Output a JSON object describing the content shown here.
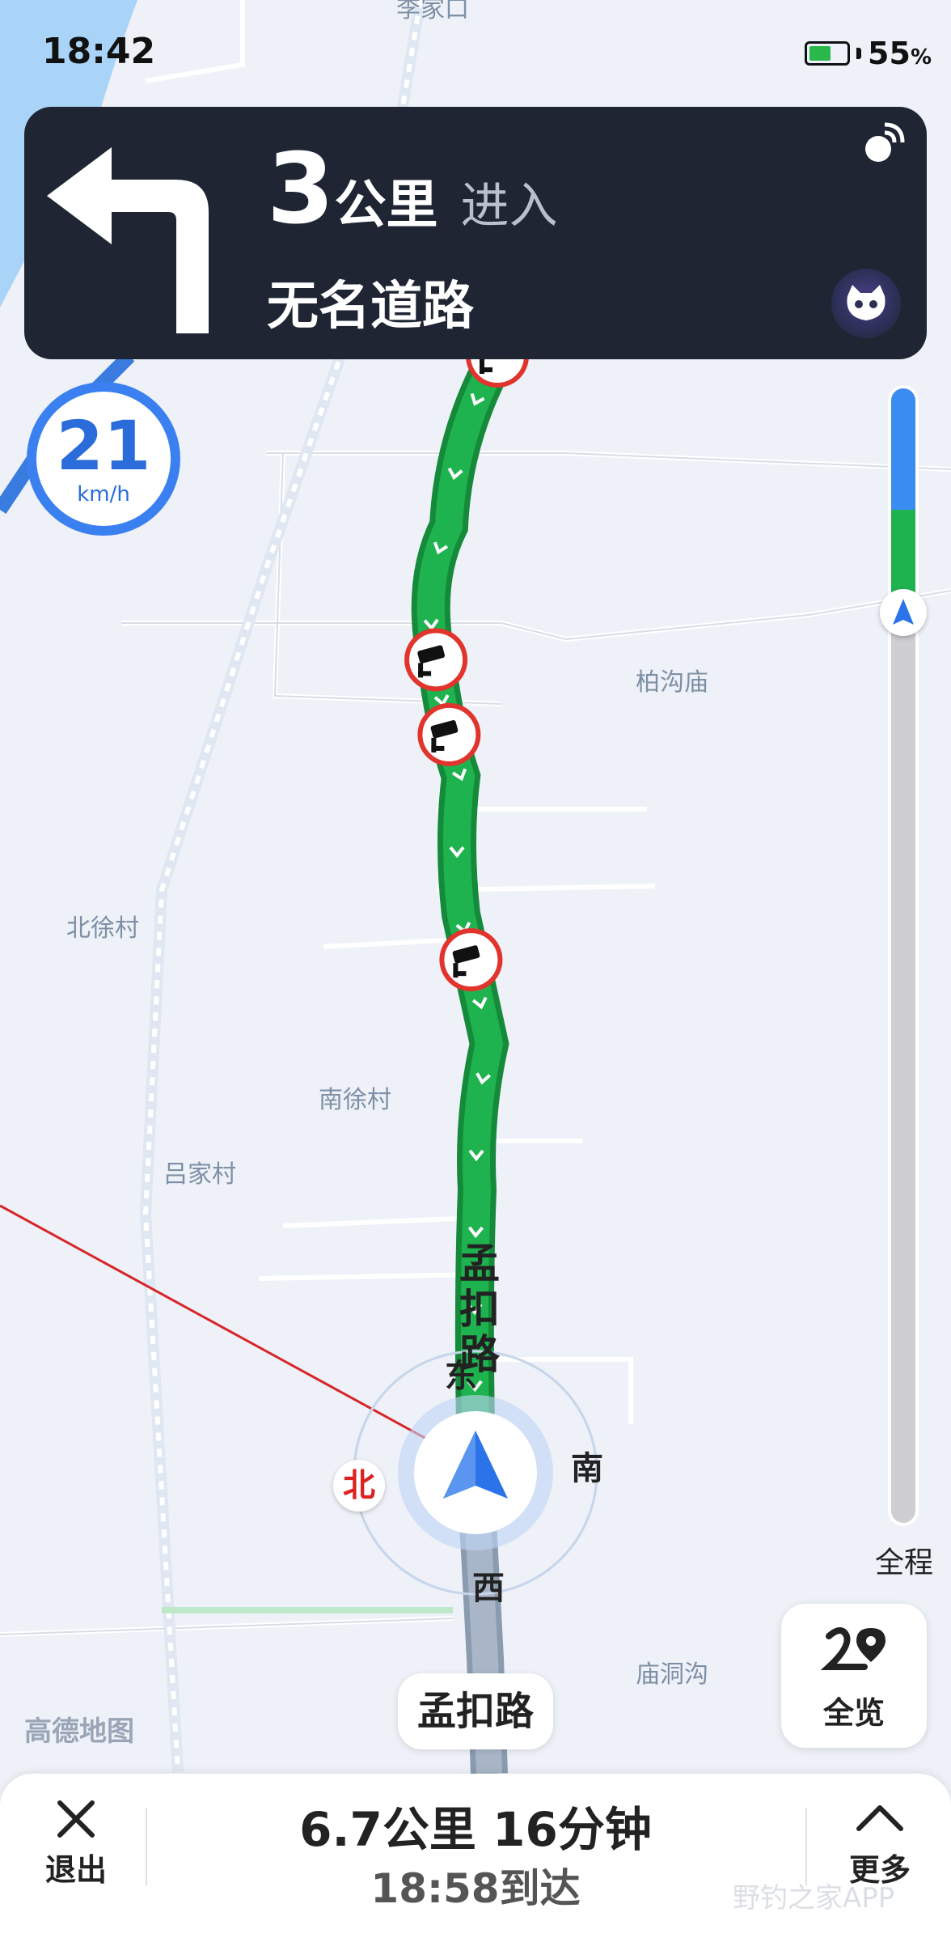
{
  "status_bar": {
    "time": "18:42",
    "battery_percent": "55",
    "battery_unit": "%"
  },
  "nav_card": {
    "distance_value": "3",
    "distance_unit": "公里",
    "action": "进入",
    "road": "无名道路"
  },
  "speed": {
    "value": "21",
    "unit": "km/h"
  },
  "map_labels": {
    "top": "李家口",
    "bogoumiao": "柏沟庙",
    "beixucun": "北徐村",
    "nanxucun": "南徐村",
    "lvjiacun": "吕家村",
    "miaodonggou": "庙洞沟",
    "current_road_vertical": "孟扣路"
  },
  "compass": {
    "north": "北",
    "south": "南",
    "east": "东",
    "west": "西"
  },
  "progress": {
    "label": "全程",
    "traveled_fraction": 0.12
  },
  "overview_button": {
    "label": "全览"
  },
  "road_pill": "孟扣路",
  "brand": "高德地图",
  "bottom_bar": {
    "exit_label": "退出",
    "summary": "6.7公里 16分钟",
    "arrival": "18:58到达",
    "more_label": "更多"
  },
  "watermark": "野钓之家APP",
  "colors": {
    "route_green": "#1fb34f",
    "card_bg": "#1f2533",
    "accent_blue": "#3a80f0",
    "camera_red": "#e0342c"
  }
}
